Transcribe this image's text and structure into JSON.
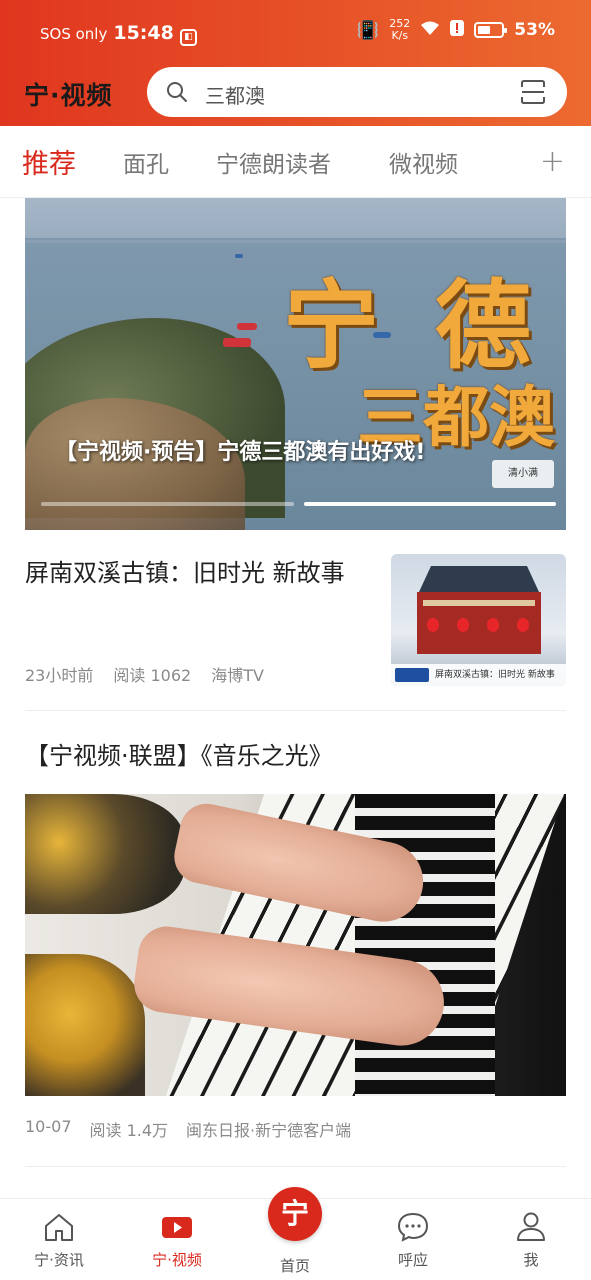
{
  "status_bar": {
    "carrier": "SOS only",
    "time": "15:48",
    "net_speed_value": "252",
    "net_speed_unit": "K/s",
    "battery": "53%",
    "battery_level": 0.53
  },
  "app_bar": {
    "logo": "宁·视频",
    "search_placeholder": "三都澳"
  },
  "tabs": [
    {
      "label": "推荐",
      "active": true
    },
    {
      "label": "面孔",
      "active": false
    },
    {
      "label": "宁德朗读者",
      "active": false
    },
    {
      "label": "微视频",
      "active": false
    }
  ],
  "tab_add": "+",
  "banner": {
    "overlay_big_1": "宁",
    "overlay_big_2": "德",
    "overlay_sub": "三都澳",
    "caption": "【宁视频·预告】宁德三都澳有出好戏!",
    "watermark": "清小满",
    "slide_count": 2,
    "active_slide": 2
  },
  "articles": [
    {
      "title": "屏南双溪古镇：旧时光 新故事",
      "time": "23小时前",
      "reads": "阅读 1062",
      "source": "海博TV",
      "thumb_caption": "屏南双溪古镇：旧时光 新故事"
    },
    {
      "title": "【宁视频·联盟】《音乐之光》",
      "time": "10-07",
      "reads": "阅读 1.4万",
      "source": "闽东日报·新宁德客户端"
    }
  ],
  "bottom_nav": [
    {
      "label": "宁·资讯",
      "icon": "home-outline-icon",
      "active": false
    },
    {
      "label": "宁·视频",
      "icon": "video-play-icon",
      "active": true
    },
    {
      "label": "首页",
      "icon": "ning-logo-icon",
      "active": false
    },
    {
      "label": "呼应",
      "icon": "chat-bubble-icon",
      "active": false
    },
    {
      "label": "我",
      "icon": "person-icon",
      "active": false
    }
  ],
  "home_badge": "宁",
  "colors": {
    "accent": "#d9281c",
    "header_gradient_start": "#e0361f",
    "header_gradient_end": "#ec6a30"
  }
}
